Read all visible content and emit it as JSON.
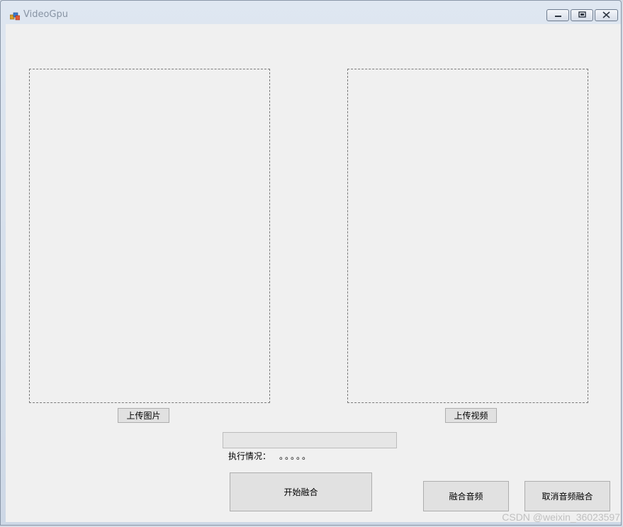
{
  "window": {
    "title": "VideoGpu"
  },
  "left_panel": {
    "upload_label": "上传图片"
  },
  "right_panel": {
    "upload_label": "上传视频"
  },
  "status": {
    "label": "执行情况：",
    "value": "。。。。。"
  },
  "actions": {
    "start_merge_label": "开始融合",
    "merge_audio_label": "融合音频",
    "cancel_audio_merge_label": "取消音频融合"
  },
  "watermark": {
    "text": "CSDN @weixin_36023597"
  }
}
